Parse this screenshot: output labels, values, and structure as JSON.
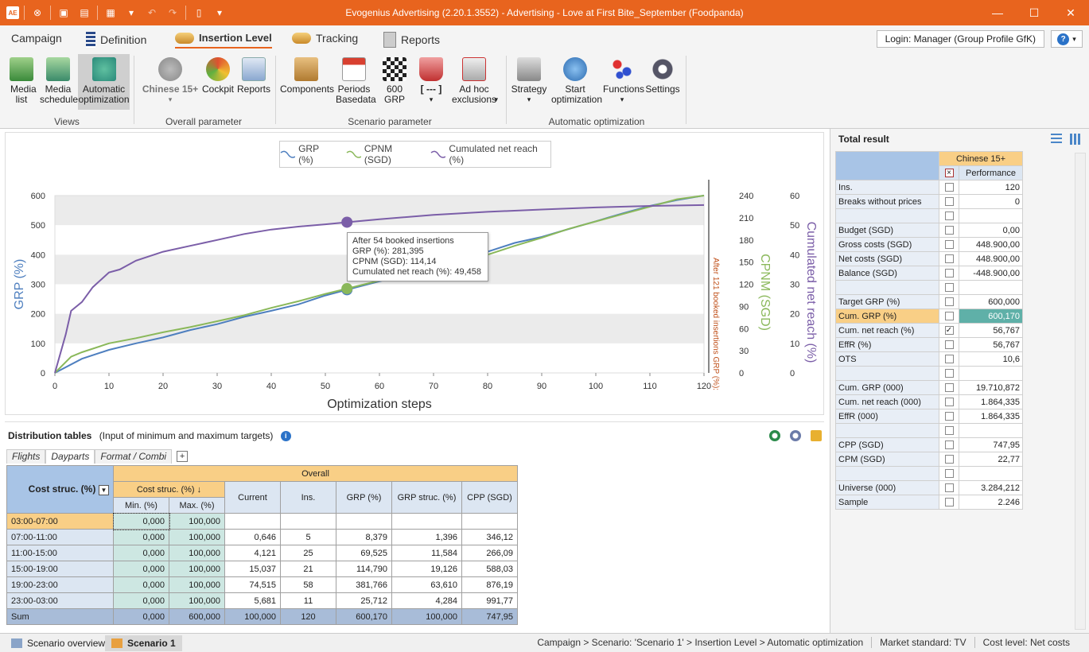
{
  "window": {
    "title": "Evogenius Advertising (2.20.1.3552) - Advertising - Love at First Bite_September (Foodpanda)"
  },
  "ribbon_tabs": [
    "Campaign",
    "Definition",
    "Insertion Level",
    "Tracking",
    "Reports"
  ],
  "login_label": "Login: Manager (Group Profile GfK)",
  "ribbon": {
    "views": {
      "label": "Views",
      "buttons": [
        "Media list",
        "Media schedule",
        "Automatic optimization"
      ]
    },
    "overall": {
      "label": "Overall parameter",
      "buttons": [
        "Chinese 15+",
        "Cockpit",
        "Reports"
      ]
    },
    "scenario": {
      "label": "Scenario parameter",
      "buttons": [
        "Components",
        "Periods Basedata",
        "600 GRP",
        "[ --- ]",
        "Ad hoc exclusions"
      ]
    },
    "auto": {
      "label": "Automatic optimization",
      "buttons": [
        "Strategy",
        "Start optimization",
        "Functions",
        "Settings"
      ]
    }
  },
  "chart_data": {
    "type": "line",
    "legend": [
      "GRP (%)",
      "CPNM (SGD)",
      "Cumulated net reach (%)"
    ],
    "xlabel": "Optimization steps",
    "ylabel_left": "GRP (%)",
    "ylabel_right1": "CPNM (SGD)",
    "ylabel_right2": "Cumulated net reach (%)",
    "xlim": [
      0,
      120
    ],
    "ylim_left": [
      0,
      600
    ],
    "ylim_right1": [
      0,
      240
    ],
    "ylim_right2": [
      0,
      60
    ],
    "x_ticks": [
      "0",
      "10",
      "20",
      "30",
      "40",
      "50",
      "60",
      "70",
      "80",
      "90",
      "100",
      "110",
      "120"
    ],
    "y_ticks_left": [
      "0",
      "100",
      "200",
      "300",
      "400",
      "500",
      "600"
    ],
    "y_ticks_right1": [
      "0",
      "30",
      "60",
      "90",
      "120",
      "150",
      "180",
      "210",
      "240"
    ],
    "y_ticks_right2": [
      "0",
      "10",
      "20",
      "30",
      "40",
      "50",
      "60"
    ],
    "vline_label": "After 121 booked insertions GRP (%):",
    "colors": {
      "grp": "#4e7fbf",
      "cpnm": "#8ab85a",
      "reach": "#7b5ea8"
    },
    "series": [
      {
        "name": "GRP (%)",
        "x": [
          0,
          5,
          10,
          15,
          20,
          25,
          30,
          35,
          40,
          45,
          50,
          54,
          60,
          65,
          70,
          75,
          80,
          85,
          90,
          95,
          100,
          105,
          110,
          115,
          120
        ],
        "values": [
          0,
          48,
          78,
          100,
          120,
          145,
          165,
          190,
          210,
          232,
          262,
          281.4,
          310,
          330,
          355,
          385,
          410,
          440,
          460,
          487,
          513,
          540,
          565,
          585,
          600.2
        ]
      },
      {
        "name": "CPNM (SGD)",
        "x": [
          0,
          3,
          5,
          10,
          15,
          20,
          25,
          30,
          35,
          40,
          45,
          50,
          54,
          60,
          65,
          70,
          75,
          80,
          85,
          90,
          95,
          100,
          105,
          110,
          115,
          120
        ],
        "values": [
          0,
          22,
          28,
          40,
          47,
          55,
          62,
          70,
          78,
          88,
          97,
          107,
          114.1,
          125,
          133,
          140,
          150,
          160,
          172,
          183,
          195,
          205,
          215,
          225,
          235,
          240
        ]
      },
      {
        "name": "Cumulated net reach (%)",
        "x": [
          0,
          2,
          3,
          5,
          7,
          10,
          12,
          15,
          20,
          25,
          30,
          35,
          40,
          45,
          50,
          54,
          60,
          70,
          80,
          90,
          100,
          110,
          120
        ],
        "values": [
          0,
          13,
          21,
          24,
          29,
          34,
          35,
          38,
          41,
          43,
          45,
          47,
          48.5,
          49.5,
          50.3,
          51,
          52,
          53.5,
          54.5,
          55.3,
          56,
          56.5,
          56.8
        ]
      }
    ],
    "tooltip": {
      "title": "After 54 booked insertions",
      "lines": [
        "GRP (%): 281,395",
        "CPNM (SGD): 114,14",
        "Cumulated net reach (%): 49,458"
      ],
      "x": 54
    }
  },
  "distribution": {
    "title": "Distribution tables",
    "subtitle": "(Input of minimum and maximum targets)",
    "tabs": [
      "Flights",
      "Dayparts",
      "Format / Combi"
    ],
    "corner_label": "Cost struc. (%)",
    "group_header": "Overall",
    "sub_group_header": "Cost struc. (%) ↓",
    "columns": [
      "Min. (%)",
      "Max. (%)",
      "Current",
      "Ins.",
      "GRP (%)",
      "GRP struc. (%)",
      "CPP (SGD)"
    ],
    "rows": [
      {
        "label": "03:00-07:00",
        "cells": [
          "0,000",
          "100,000",
          "",
          "",
          "",
          "",
          ""
        ]
      },
      {
        "label": "07:00-11:00",
        "cells": [
          "0,000",
          "100,000",
          "0,646",
          "5",
          "8,379",
          "1,396",
          "346,12"
        ]
      },
      {
        "label": "11:00-15:00",
        "cells": [
          "0,000",
          "100,000",
          "4,121",
          "25",
          "69,525",
          "11,584",
          "266,09"
        ]
      },
      {
        "label": "15:00-19:00",
        "cells": [
          "0,000",
          "100,000",
          "15,037",
          "21",
          "114,790",
          "19,126",
          "588,03"
        ]
      },
      {
        "label": "19:00-23:00",
        "cells": [
          "0,000",
          "100,000",
          "74,515",
          "58",
          "381,766",
          "63,610",
          "876,19"
        ]
      },
      {
        "label": "23:00-03:00",
        "cells": [
          "0,000",
          "100,000",
          "5,681",
          "11",
          "25,712",
          "4,284",
          "991,77"
        ]
      }
    ],
    "sum": {
      "label": "Sum",
      "cells": [
        "0,000",
        "600,000",
        "100,000",
        "120",
        "600,170",
        "100,000",
        "747,95"
      ]
    }
  },
  "total_result": {
    "title": "Total result",
    "target_group": "Chinese 15+",
    "column_label": "Performance",
    "rows": [
      {
        "label": "Ins.",
        "value": "120",
        "checked": false
      },
      {
        "label": "Breaks without prices",
        "value": "0",
        "checked": false
      },
      {
        "label": "",
        "value": "",
        "checked": false
      },
      {
        "label": "Budget (SGD)",
        "value": "0,00",
        "checked": false
      },
      {
        "label": "Gross costs (SGD)",
        "value": "448.900,00",
        "checked": false
      },
      {
        "label": "Net costs (SGD)",
        "value": "448.900,00",
        "checked": false
      },
      {
        "label": "Balance (SGD)",
        "value": "-448.900,00",
        "checked": false
      },
      {
        "label": "",
        "value": "",
        "checked": false
      },
      {
        "label": "Target GRP (%)",
        "value": "600,000",
        "checked": false
      },
      {
        "label": "Cum. GRP (%)",
        "value": "600,170",
        "checked": false,
        "highlight": true
      },
      {
        "label": "Cum. net reach (%)",
        "value": "56,767",
        "checked": true
      },
      {
        "label": "EffR (%)",
        "value": "56,767",
        "checked": false
      },
      {
        "label": "OTS",
        "value": "10,6",
        "checked": false
      },
      {
        "label": "",
        "value": "",
        "checked": false
      },
      {
        "label": "Cum. GRP (000)",
        "value": "19.710,872",
        "checked": false
      },
      {
        "label": "Cum. net reach (000)",
        "value": "1.864,335",
        "checked": false
      },
      {
        "label": "EffR (000)",
        "value": "1.864,335",
        "checked": false
      },
      {
        "label": "",
        "value": "",
        "checked": false
      },
      {
        "label": "CPP (SGD)",
        "value": "747,95",
        "checked": false
      },
      {
        "label": "CPM (SGD)",
        "value": "22,77",
        "checked": false
      },
      {
        "label": "",
        "value": "",
        "checked": false
      },
      {
        "label": "Universe (000)",
        "value": "3.284,212",
        "checked": false
      },
      {
        "label": "Sample",
        "value": "2.246",
        "checked": false
      }
    ]
  },
  "statusbar": {
    "tab1": "Scenario overview",
    "tab2": "Scenario 1",
    "breadcrumb": "Campaign > Scenario: 'Scenario 1' > Insertion Level > Automatic optimization",
    "market": "Market standard: TV",
    "cost_level": "Cost level: Net costs"
  }
}
